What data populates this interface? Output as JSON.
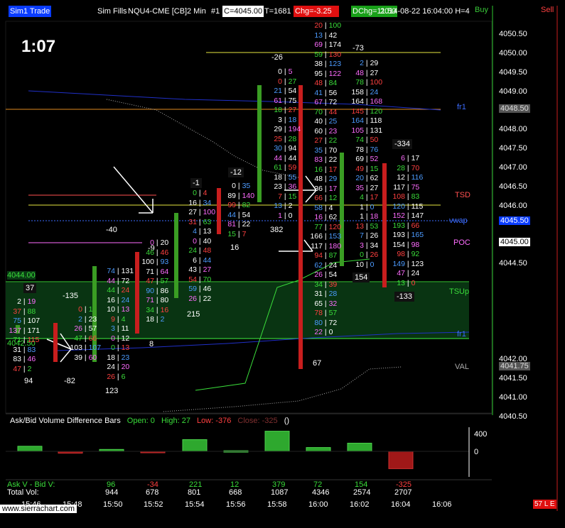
{
  "header": {
    "title_prefix": "Sim1 Trade",
    "sim_fills": "Sim Fills",
    "symbol": "NQU4-CME [CB]",
    "interval": "2 Min",
    "chart_num": "#1",
    "close": "C=4045.00",
    "trades": "T=1681",
    "chg": "Chg=-3.25",
    "dchg": "DChg=11.50",
    "datetime": "2014-08-22  16:04:00 H=4",
    "buy": "Buy",
    "sell": "Sell"
  },
  "clock": "1:07",
  "price_axis": [
    "4050.50",
    "4050.00",
    "4049.50",
    "4049.00",
    "4048.50",
    "4048.00",
    "4047.50",
    "4047.00",
    "4046.50",
    "4046.00",
    "4045.50",
    "4045.00",
    "4044.50",
    "4044.00",
    "4043.50",
    "4043.00",
    "4042.50",
    "4042.00",
    "4041.75",
    "4041.50",
    "4041.00",
    "4040.50"
  ],
  "price_tags": {
    "current": "4045.00",
    "vwap_tag": "4045.50",
    "ma_tag": "4048.50",
    "val_tag": "4041.75"
  },
  "left_labels": {
    "tsup_price": "4044.00",
    "lower_price": "4042.50"
  },
  "line_labels": {
    "tsd": "TSD",
    "vwap": "vwap",
    "poc": "POC",
    "tsup": "TSUp",
    "val": "VAL",
    "ema": "fr1"
  },
  "bar_totals": [
    "94",
    "-82",
    "123",
    "-135",
    "37",
    "-40",
    "-9",
    "8",
    "-1",
    "215",
    "-12",
    "16",
    "-26",
    "382",
    "67",
    "-73",
    "154",
    "-334",
    "-133"
  ],
  "clusters": [
    {
      "rows": [
        [
          "2",
          "19"
        ],
        [
          "37",
          "88"
        ],
        [
          "75",
          "107"
        ],
        [
          "137",
          "171"
        ],
        [
          "71",
          "115"
        ],
        [
          "31",
          "83"
        ],
        [
          "83",
          "46"
        ],
        [
          "47",
          "2"
        ]
      ]
    },
    {
      "rows": [
        [
          "0",
          "1"
        ],
        [
          "2",
          "23"
        ],
        [
          "26",
          "57"
        ],
        [
          "47",
          "66"
        ],
        [
          "103",
          "107"
        ],
        [
          "39",
          "60"
        ]
      ]
    },
    {
      "rows": [
        [
          "74",
          "131"
        ],
        [
          "44",
          "72"
        ],
        [
          "44",
          "24"
        ],
        [
          "16",
          "24"
        ],
        [
          "10",
          "13"
        ],
        [
          "9",
          "4"
        ],
        [
          "3",
          "11"
        ],
        [
          "0",
          "12"
        ],
        [
          "0",
          "13"
        ],
        [
          "18",
          "23"
        ],
        [
          "24",
          "20"
        ],
        [
          "26",
          "6"
        ]
      ]
    },
    {
      "rows": [
        [
          "0",
          "20"
        ],
        [
          "46",
          "46"
        ],
        [
          "100",
          "93"
        ],
        [
          "71",
          "64"
        ],
        [
          "47",
          "57"
        ],
        [
          "90",
          "86"
        ],
        [
          "71",
          "80"
        ],
        [
          "34",
          "16"
        ],
        [
          "18",
          "2"
        ]
      ]
    },
    {
      "rows": [
        [
          "0",
          "4"
        ],
        [
          "16",
          "34"
        ],
        [
          "27",
          "100"
        ],
        [
          "31",
          "63"
        ],
        [
          "4",
          "13"
        ],
        [
          "0",
          "40"
        ],
        [
          "24",
          "48"
        ],
        [
          "6",
          "44"
        ],
        [
          "43",
          "27"
        ],
        [
          "54",
          "70"
        ],
        [
          "59",
          "46"
        ],
        [
          "26",
          "22"
        ]
      ]
    },
    {
      "rows": [
        [
          "0",
          "35"
        ],
        [
          "89",
          "140"
        ],
        [
          "99",
          "82"
        ],
        [
          "44",
          "54"
        ],
        [
          "81",
          "22"
        ],
        [
          "15",
          "7"
        ]
      ]
    },
    {
      "rows": [
        [
          "0",
          "5"
        ],
        [
          "0",
          "27"
        ],
        [
          "21",
          "54"
        ],
        [
          "61",
          "75"
        ],
        [
          "18",
          "27"
        ],
        [
          "3",
          "18"
        ],
        [
          "29",
          "194"
        ],
        [
          "25",
          "28"
        ],
        [
          "30",
          "94"
        ],
        [
          "44",
          "44"
        ],
        [
          "61",
          "59"
        ],
        [
          "18",
          "55"
        ],
        [
          "23",
          "36"
        ],
        [
          "7",
          "15"
        ],
        [
          "13",
          "2"
        ],
        [
          "1",
          "0"
        ]
      ]
    },
    {
      "rows": [
        [
          "20",
          "100"
        ],
        [
          "13",
          "42"
        ],
        [
          "69",
          "174"
        ],
        [
          "59",
          "130"
        ],
        [
          "38",
          "123"
        ],
        [
          "95",
          "122"
        ],
        [
          "48",
          "84"
        ],
        [
          "41",
          "56"
        ],
        [
          "67",
          "72"
        ],
        [
          "70",
          "44"
        ],
        [
          "40",
          "25"
        ],
        [
          "60",
          "23"
        ],
        [
          "27",
          "22"
        ],
        [
          "35",
          "70"
        ],
        [
          "83",
          "22"
        ],
        [
          "16",
          "17"
        ],
        [
          "48",
          "29"
        ],
        [
          "36",
          "17"
        ],
        [
          "66",
          "12"
        ],
        [
          "58",
          "4"
        ],
        [
          "16",
          "62"
        ],
        [
          "77",
          "120"
        ],
        [
          "166",
          "153"
        ],
        [
          "117",
          "180"
        ],
        [
          "94",
          "87"
        ],
        [
          "62",
          "24"
        ],
        [
          "26",
          "54"
        ],
        [
          "34",
          "39"
        ],
        [
          "31",
          "28"
        ],
        [
          "65",
          "32"
        ],
        [
          "78",
          "57"
        ],
        [
          "80",
          "72"
        ],
        [
          "22",
          "0"
        ]
      ]
    },
    {
      "rows": [
        [
          "2",
          "29"
        ],
        [
          "48",
          "27"
        ],
        [
          "78",
          "100"
        ],
        [
          "158",
          "24"
        ],
        [
          "164",
          "168"
        ],
        [
          "145",
          "120"
        ],
        [
          "164",
          "118"
        ],
        [
          "105",
          "131"
        ],
        [
          "74",
          "50"
        ],
        [
          "78",
          "76"
        ],
        [
          "69",
          "52"
        ],
        [
          "49",
          "15"
        ],
        [
          "20",
          "62"
        ],
        [
          "35",
          "27"
        ],
        [
          "4",
          "17"
        ],
        [
          "1",
          "0"
        ],
        [
          "1",
          "18"
        ],
        [
          "13",
          "53"
        ],
        [
          "7",
          "26"
        ],
        [
          "3",
          "34"
        ],
        [
          "0",
          "26"
        ],
        [
          "10",
          "0"
        ]
      ]
    },
    {
      "rows": [
        [
          "6",
          "17"
        ],
        [
          "28",
          "70"
        ],
        [
          "12",
          "116"
        ],
        [
          "117",
          "75"
        ],
        [
          "108",
          "83"
        ],
        [
          "120",
          "115"
        ],
        [
          "152",
          "147"
        ],
        [
          "193",
          "66"
        ],
        [
          "193",
          "165"
        ],
        [
          "154",
          "98"
        ],
        [
          "98",
          "92"
        ],
        [
          "149",
          "123"
        ],
        [
          "47",
          "24"
        ],
        [
          "13",
          "0"
        ]
      ]
    }
  ],
  "subchart": {
    "title": "Ask/Bid Volume Difference Bars",
    "open": "Open: 0",
    "high": "High: 27",
    "low": "Low: -376",
    "close": "Close: -325",
    "marker": "()",
    "axis_top": "400",
    "axis_zero": "0"
  },
  "summary": {
    "row1_label": "Ask V - Bid V:",
    "row2_label": "Total Vol:",
    "diff": [
      "96",
      "-34",
      "221",
      "12",
      "379",
      "72",
      "154",
      "-325"
    ],
    "total": [
      "944",
      "678",
      "801",
      "668",
      "1087",
      "4346",
      "2574",
      "2707"
    ]
  },
  "time_axis": [
    "15:46",
    "15:48",
    "15:50",
    "15:52",
    "15:54",
    "15:56",
    "15:58",
    "16:00",
    "16:02",
    "16:04",
    "16:06"
  ],
  "footer": {
    "url": "www.sierrachart.com",
    "badge": "57 L E"
  },
  "colors": {
    "bg": "#000000",
    "up": "#3a9d23",
    "down": "#c81e1e",
    "ask": "#ffffff",
    "bid": "#ffffff",
    "yellow_line": "#e6e640",
    "vwap": "#3c6cff",
    "poc": "#ff6cff",
    "tsd": "#ff5050",
    "tsup": "#0a3a14"
  }
}
